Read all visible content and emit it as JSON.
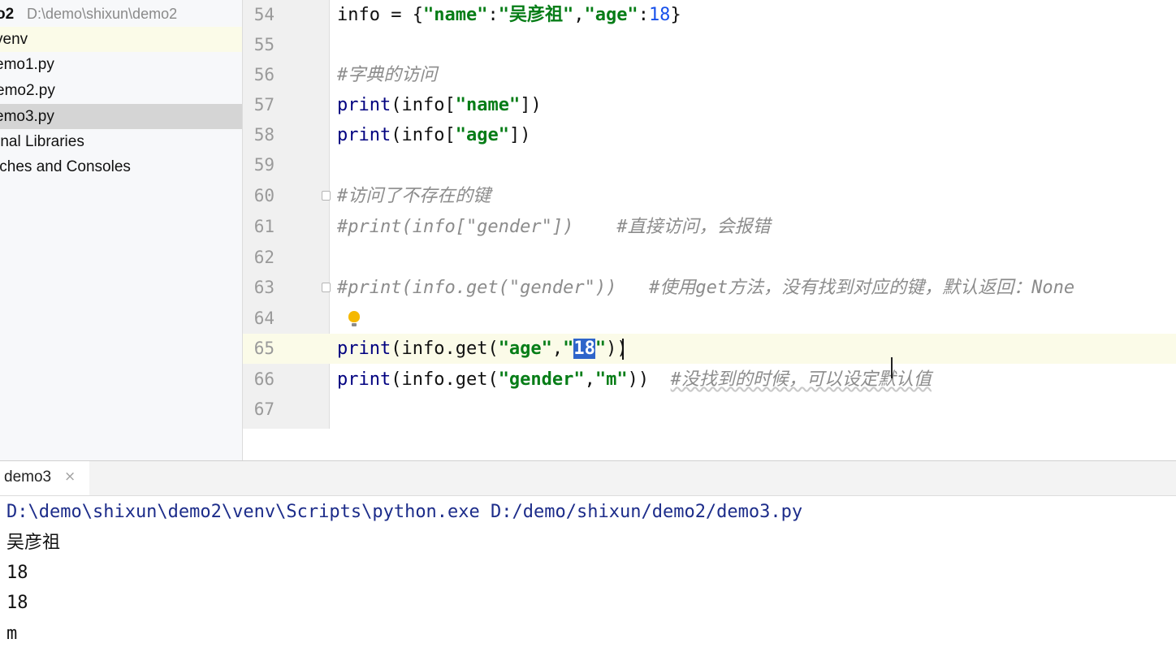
{
  "project_tree": {
    "root_name": "o2",
    "root_path": "D:\\demo\\shixun\\demo2",
    "items": [
      {
        "label": "venv"
      },
      {
        "label": "emo1.py"
      },
      {
        "label": "emo2.py"
      },
      {
        "label": "emo3.py",
        "selected": true
      },
      {
        "label": "rnal Libraries"
      },
      {
        "label": "tches and Consoles"
      }
    ]
  },
  "editor": {
    "lines": [
      {
        "number": "54",
        "text": "info = {\"name\":\"吴彦祖\",\"age\":18}"
      },
      {
        "number": "55",
        "text": ""
      },
      {
        "number": "56",
        "text": "#字典的访问"
      },
      {
        "number": "57",
        "text": "print(info[\"name\"])"
      },
      {
        "number": "58",
        "text": "print(info[\"age\"])"
      },
      {
        "number": "59",
        "text": ""
      },
      {
        "number": "60",
        "text": "#访问了不存在的键"
      },
      {
        "number": "61",
        "text": "#print(info[\"gender\"])    #直接访问，会报错"
      },
      {
        "number": "62",
        "text": ""
      },
      {
        "number": "63",
        "text": "#print(info.get(\"gender\"))   #使用get方法，没有找到对应的键，默认返回：None"
      },
      {
        "number": "64",
        "text": ""
      },
      {
        "number": "65",
        "text": "print(info.get(\"age\",\"18\"))",
        "current": true
      },
      {
        "number": "66",
        "text": "print(info.get(\"gender\",\"m\"))  #没找到的时候，可以设定默认值"
      },
      {
        "number": "67",
        "text": ""
      }
    ],
    "selected_text": "18",
    "intention_icon": "lightbulb-icon"
  },
  "run_panel": {
    "tab_label": "demo3",
    "tab_close": "×",
    "output": [
      "D:\\demo\\shixun\\demo2\\venv\\Scripts\\python.exe D:/demo/shixun/demo2/demo3.py",
      "吴彦祖",
      "18",
      "18",
      "m"
    ]
  },
  "colors": {
    "keyword": "#000080",
    "string": "#067d17",
    "number": "#1750eb",
    "comment": "#8c8c8c",
    "selection": "#2f65ca",
    "current_line": "#fbfbe8",
    "run_command": "#1c2c8a"
  }
}
